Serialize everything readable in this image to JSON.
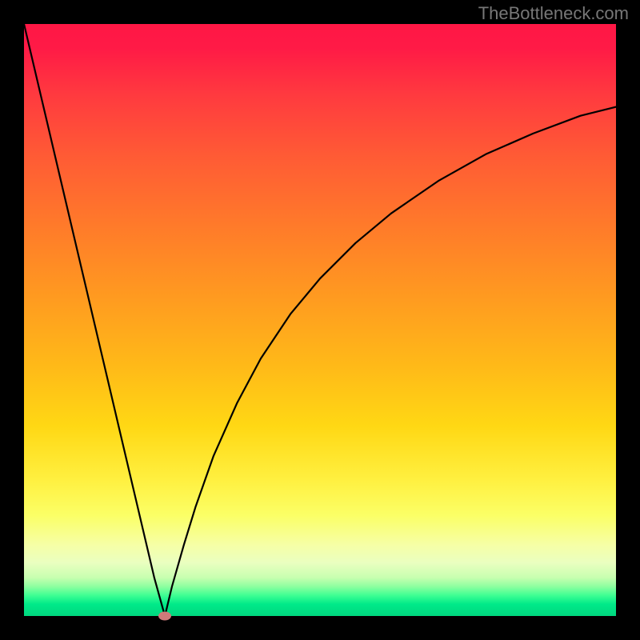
{
  "watermark": "TheBottleneck.com",
  "colors": {
    "background": "#000000",
    "curve": "#000000",
    "marker": "#d07a7a"
  },
  "chart_data": {
    "type": "line",
    "title": "",
    "xlabel": "",
    "ylabel": "",
    "xlim": [
      0,
      100
    ],
    "ylim": [
      0,
      100
    ],
    "grid": false,
    "legend": false,
    "series": [
      {
        "name": "bottleneck-curve",
        "x": [
          0,
          2,
          4,
          6,
          8,
          10,
          12,
          14,
          16,
          18,
          20,
          22,
          23.8,
          25,
          27,
          29,
          32,
          36,
          40,
          45,
          50,
          56,
          62,
          70,
          78,
          86,
          94,
          100
        ],
        "y": [
          100,
          91.5,
          83,
          74.5,
          66,
          57.5,
          49,
          40.5,
          32,
          23.5,
          15,
          6.5,
          0,
          5,
          12,
          18.5,
          27,
          36,
          43.5,
          51,
          57,
          63,
          68,
          73.5,
          78,
          81.5,
          84.5,
          86
        ]
      }
    ],
    "annotations": [
      {
        "name": "minimum-marker",
        "x": 23.8,
        "y": 0
      }
    ],
    "background_gradient": {
      "direction": "vertical",
      "stops": [
        {
          "pos": 0.0,
          "color": "#ff1745"
        },
        {
          "pos": 0.46,
          "color": "#ff9a20"
        },
        {
          "pos": 0.77,
          "color": "#fff040"
        },
        {
          "pos": 0.95,
          "color": "#8effa0"
        },
        {
          "pos": 1.0,
          "color": "#00d77f"
        }
      ]
    }
  }
}
